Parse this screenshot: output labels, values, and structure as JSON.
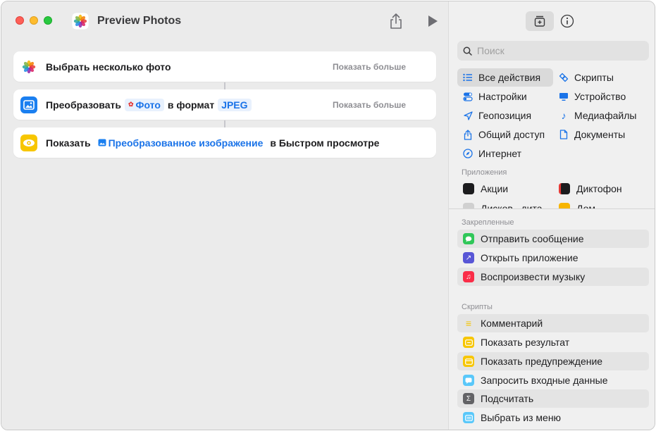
{
  "window": {
    "title": "Preview Photos"
  },
  "actions": [
    {
      "text": "Выбрать несколько фото",
      "more": "Показать больше"
    },
    {
      "prefix": "Преобразовать",
      "token1": "Фото",
      "mid": "в формат",
      "token2": "JPEG",
      "more": "Показать больше"
    },
    {
      "prefix": "Показать",
      "token1": "Преобразованное изображение",
      "suffix": "в Быстром просмотре"
    }
  ],
  "sidebar": {
    "search_placeholder": "Поиск",
    "categories_left": [
      "Все действия",
      "Настройки",
      "Геопозиция",
      "Общий доступ",
      "Интернет"
    ],
    "categories_right": [
      "Скрипты",
      "Устройство",
      "Медиафайлы",
      "Документы"
    ],
    "apps_label": "Приложения",
    "apps": [
      "Акции",
      "Диктофон",
      "Дисков...дита",
      "Дом"
    ],
    "pinned_label": "Закрепленные",
    "pinned": [
      "Отправить сообщение",
      "Открыть приложение",
      "Воспроизвести музыку"
    ],
    "scripts_label": "Скрипты",
    "scripts": [
      "Комментарий",
      "Показать результат",
      "Показать предупреждение",
      "Запросить входные данные",
      "Подсчитать",
      "Выбрать из меню"
    ]
  },
  "colors": {
    "accent": "#1a73e8",
    "red": "#fe5f57",
    "yellow": "#febc2e",
    "green": "#28c840"
  }
}
